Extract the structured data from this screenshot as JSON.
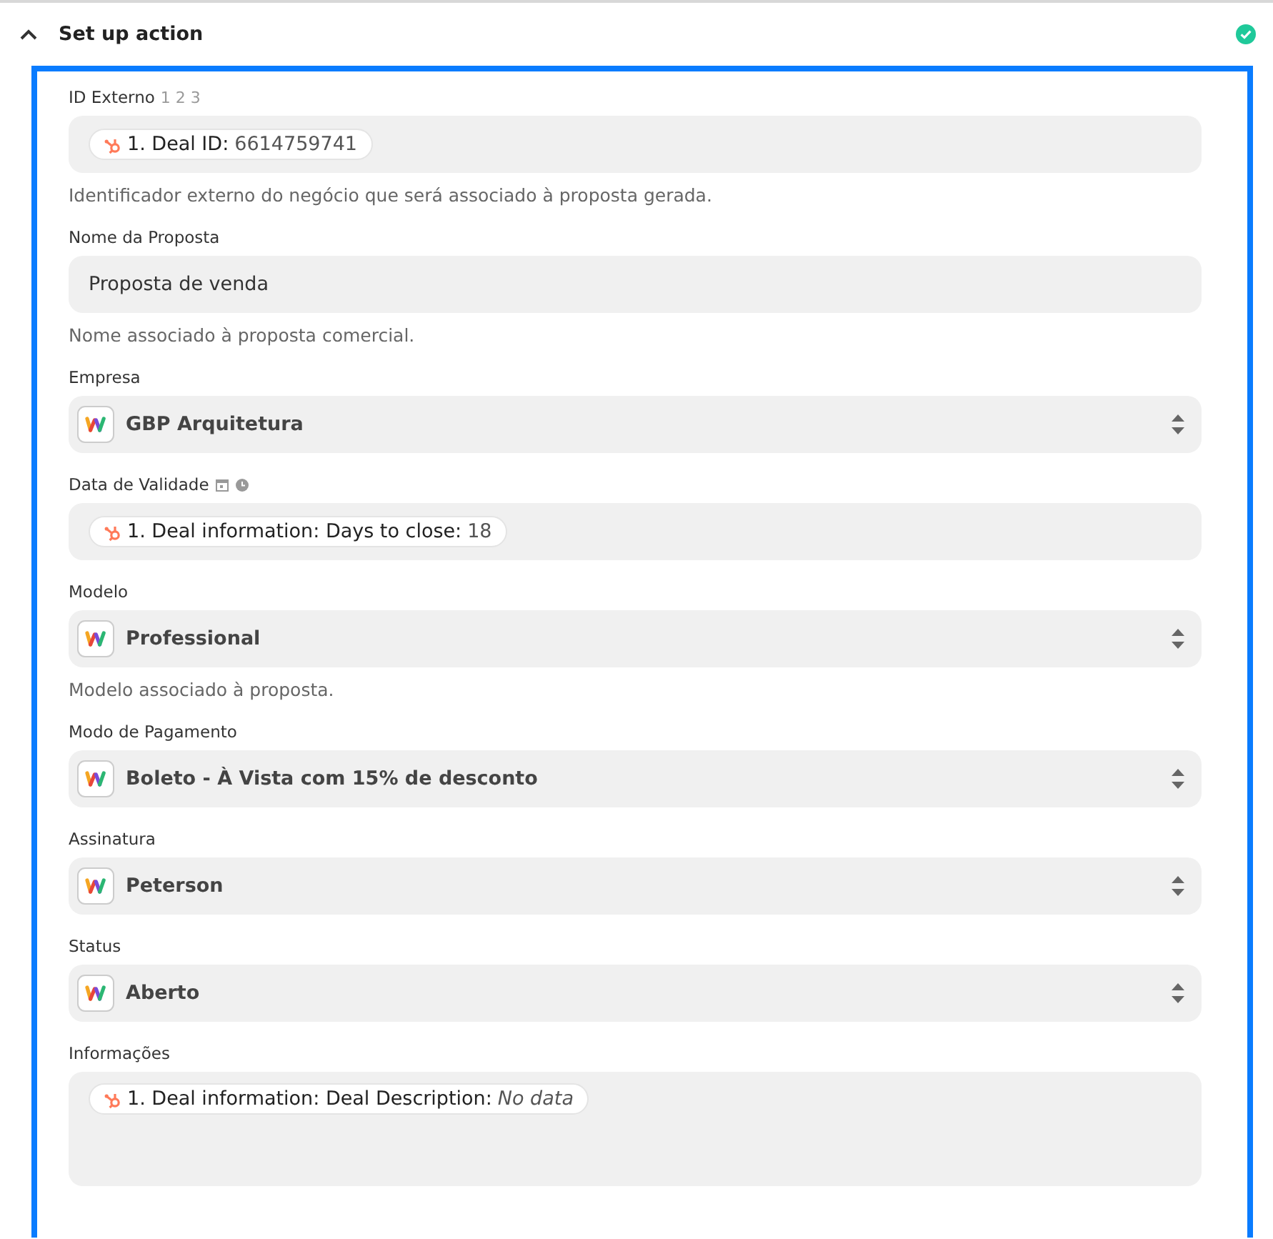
{
  "section": {
    "title": "Set up action",
    "expanded": true,
    "complete": true
  },
  "fields": [
    {
      "label": "ID Externo",
      "label_hint": "1 2 3",
      "kind": "pill",
      "pills": [
        {
          "label": "1. Deal ID:",
          "value": "6614759741",
          "missing": false
        }
      ],
      "help": "Identificador externo do negócio que será associado à proposta gerada."
    },
    {
      "label": "Nome da Proposta",
      "kind": "text",
      "value": "Proposta de venda",
      "help": "Nome associado à proposta comercial."
    },
    {
      "label": "Empresa",
      "kind": "select",
      "value": "GBP Arquitetura"
    },
    {
      "label": "Data de Validade",
      "date_time_hint": true,
      "kind": "pill",
      "pills": [
        {
          "label": "1. Deal information: Days to close:",
          "value": "18",
          "missing": false
        }
      ]
    },
    {
      "label": "Modelo",
      "kind": "select",
      "value": "Professional",
      "help": "Modelo associado à proposta."
    },
    {
      "label": "Modo de Pagamento",
      "kind": "select",
      "value": "Boleto - À Vista com 15% de desconto"
    },
    {
      "label": "Assinatura",
      "kind": "select",
      "value": "Peterson"
    },
    {
      "label": "Status",
      "kind": "select",
      "value": "Aberto"
    },
    {
      "label": "Informações",
      "kind": "textarea",
      "pills": [
        {
          "label": "1. Deal information: Deal Description:",
          "value": "No data",
          "missing": true
        }
      ]
    }
  ]
}
